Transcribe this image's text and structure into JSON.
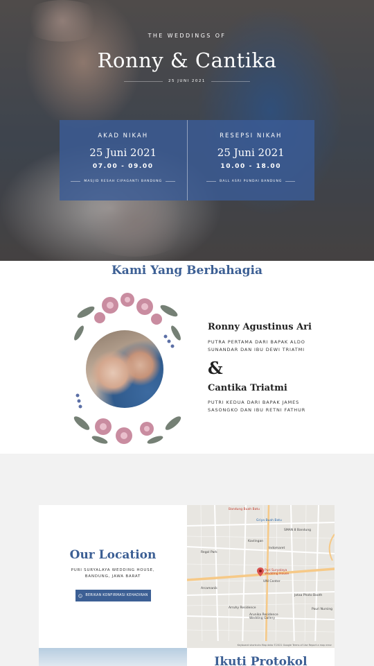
{
  "hero": {
    "kicker": "THE WEDDINGS OF",
    "title": "Ronny & Cantika",
    "date": "25 JUNI 2021"
  },
  "events": [
    {
      "title": "AKAD NIKAH",
      "date": "25 Juni 2021",
      "time": "07.00 - 09.00",
      "place": "MASJID RESAH CIPAGANTI BANDUNG"
    },
    {
      "title": "RESEPSI NIKAH",
      "date": "25 Juni 2021",
      "time": "10.00 - 18.00",
      "place": "BALL ASRI PUNDAI BANDUNG"
    }
  ],
  "couple": {
    "heading": "Kami Yang Berbahagia",
    "groom_name": "Ronny Agustinus Ari",
    "groom_desc": "PUTRA PERTAMA DARI BAPAK ALDO SUNANDAR DAN IBU DEWI TRIATMI",
    "ampersand": "&",
    "bride_name": "Cantika Triatmi",
    "bride_desc": "PUTRI KEDUA DARI BAPAK JAMES SASONGKO DAN IBU RETNI FATHUR"
  },
  "location": {
    "title": "Our Location",
    "address": "PURI SURYALAYA WEDDING HOUSE, BANDUNG, JAWA BARAT",
    "button_label": "BERIKAN KONFIRMASI KEHADIRAN",
    "map_labels": {
      "bbb": "Bandung Buah Batu",
      "griya": "Griya Buah Batu",
      "sman": "SMAN 8 Bandung",
      "kavling": "Kavlingan",
      "regol": "Regol Park",
      "indomaret": "Indomaret",
      "puri": "Puri Suryalaya Wedding House",
      "unicenter": "UNI Center",
      "arcamanik": "Arcamanik",
      "jotaa": "Jotaa Photo Booth",
      "arruhy": "Arruhy Residence",
      "griya2": "Arunika Residence Wedding Gallery",
      "cepat": "Pauri Nursing",
      "credit": "Keyboard shortcuts  Map data ©2021 Google  Terms of Use  Report a map error"
    }
  },
  "protocol": {
    "title": "Ikuti Protokol"
  },
  "colors": {
    "primary": "#3c5f94",
    "card": "#3a5c96"
  },
  "icons": {
    "button": "whatsapp-icon",
    "pin": "map-pin-icon"
  }
}
